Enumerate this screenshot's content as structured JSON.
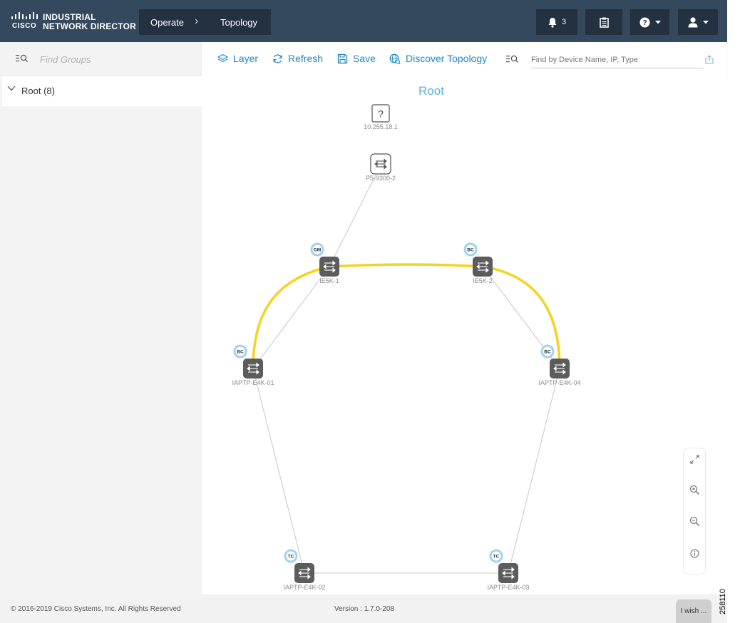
{
  "header": {
    "logo_brand": "CISCO",
    "logo_line1": "INDUSTRIAL",
    "logo_line2": "NETWORK DIRECTOR",
    "breadcrumb": [
      "Operate",
      "Topology"
    ],
    "notifications_count": "3",
    "bell_icon": "bell-icon",
    "clipboard_icon": "clipboard-icon",
    "help_icon": "question-circle-icon",
    "user_icon": "user-icon"
  },
  "sidebar": {
    "search_placeholder": "Find Groups",
    "tree": [
      {
        "label": "Root (8)",
        "expanded": true
      }
    ]
  },
  "toolbar": {
    "layer_label": "Layer",
    "refresh_label": "Refresh",
    "save_label": "Save",
    "discover_label": "Discover Topology",
    "search_placeholder": "Find by Device Name, IP, Type",
    "accent": "#1e88c7"
  },
  "canvas": {
    "title": "Root",
    "nodes": [
      {
        "id": "unknown",
        "label": "10.255.18.1",
        "icon": "question-icon",
        "badge": ""
      },
      {
        "id": "p5",
        "label": "P5-9300-2",
        "icon": "switch-icon",
        "badge": ""
      },
      {
        "id": "ie5k1",
        "label": "IE5K-1",
        "icon": "switch-icon",
        "badge": "GM"
      },
      {
        "id": "ie5k2",
        "label": "IE5K-2",
        "icon": "switch-icon",
        "badge": "BC"
      },
      {
        "id": "e4k01",
        "label": "IAPTP-E4K-01",
        "icon": "switch-icon",
        "badge": "BC"
      },
      {
        "id": "e4k04",
        "label": "IAPTP-E4K-04",
        "icon": "switch-icon",
        "badge": "BC"
      },
      {
        "id": "e4k02",
        "label": "IAPTP-E4K-02",
        "icon": "switch-icon",
        "badge": "TC"
      },
      {
        "id": "e4k03",
        "label": "IAPTP-E4K-03",
        "icon": "switch-icon",
        "badge": "TC"
      }
    ],
    "links": [
      [
        "p5",
        "ie5k1"
      ],
      [
        "ie5k1",
        "e4k01"
      ],
      [
        "ie5k2",
        "e4k04"
      ],
      [
        "e4k01",
        "e4k02"
      ],
      [
        "e4k04",
        "e4k03"
      ],
      [
        "e4k02",
        "e4k03"
      ]
    ],
    "highlight_path": [
      "e4k01",
      "ie5k1",
      "ie5k2",
      "e4k04"
    ],
    "highlight_color": "#f5d41f",
    "link_color": "#c8c8c8",
    "node_color": "#5c5c5c",
    "badge_ring_color": "#9fd3ee"
  },
  "zoom_controls": [
    "expand-icon",
    "zoom-in-icon",
    "zoom-out-icon",
    "info-icon"
  ],
  "footer": {
    "copyright": "© 2016-2019 Cisco Systems, Inc. All Rights Reserved",
    "version": "Version : 1.7.0-208",
    "feedback_label": "I wish ..."
  },
  "figure_number": "258110"
}
